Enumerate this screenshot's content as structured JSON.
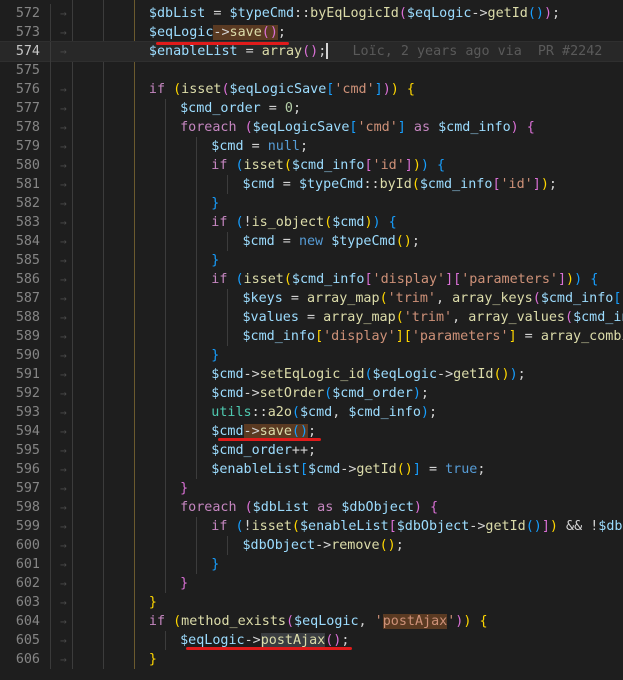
{
  "editor": {
    "current_line": 574,
    "blame": "Loïc, 2 years ago via  PR #2242",
    "lines": [
      {
        "n": "572",
        "arrows": 3,
        "tokens": [
          [
            "$dbList",
            "t-var"
          ],
          [
            " = ",
            "t-pl"
          ],
          [
            "$typeCmd",
            "t-var"
          ],
          [
            "::",
            "t-pl"
          ],
          [
            "byEqLogicId",
            "t-fn"
          ],
          [
            "(",
            "t-b2"
          ],
          [
            "$eqLogic",
            "t-var"
          ],
          [
            "->",
            "t-pl"
          ],
          [
            "getId",
            "t-fn"
          ],
          [
            "()",
            "t-b3"
          ],
          [
            ")",
            "t-b2"
          ],
          [
            ";",
            "t-pl"
          ]
        ]
      },
      {
        "n": "573",
        "arrows": 3,
        "tokens": [
          [
            "$eqLogic",
            "t-var"
          ],
          [
            "->",
            "t-pl hl-warm"
          ],
          [
            "save",
            "t-fn hl-warm"
          ],
          [
            "()",
            "t-b2 hl-warm"
          ],
          [
            ";",
            "t-pl"
          ]
        ]
      },
      {
        "n": "574",
        "arrows": 3,
        "tokens": [
          [
            "$enableList",
            "t-var"
          ],
          [
            " = ",
            "t-pl"
          ],
          [
            "array",
            "t-fn"
          ],
          [
            "()",
            "t-b2"
          ],
          [
            ";",
            "t-pl"
          ]
        ]
      },
      {
        "n": "575",
        "arrows": 0,
        "tokens": []
      },
      {
        "n": "576",
        "arrows": 3,
        "tokens": [
          [
            "if",
            "t-kw"
          ],
          [
            " ",
            "t-pl"
          ],
          [
            "(",
            "t-b1"
          ],
          [
            "isset",
            "t-fn"
          ],
          [
            "(",
            "t-b2"
          ],
          [
            "$eqLogicSave",
            "t-var"
          ],
          [
            "[",
            "t-b3"
          ],
          [
            "'cmd'",
            "t-str"
          ],
          [
            "]",
            "t-b3"
          ],
          [
            ")",
            "t-b2"
          ],
          [
            ")",
            "t-b1"
          ],
          [
            " ",
            "t-pl"
          ],
          [
            "{",
            "t-b1"
          ]
        ]
      },
      {
        "n": "577",
        "arrows": 4,
        "tokens": [
          [
            "$cmd_order",
            "t-var"
          ],
          [
            " = ",
            "t-pl"
          ],
          [
            "0",
            "t-num"
          ],
          [
            ";",
            "t-pl"
          ]
        ]
      },
      {
        "n": "578",
        "arrows": 4,
        "tokens": [
          [
            "foreach",
            "t-kw"
          ],
          [
            " ",
            "t-pl"
          ],
          [
            "(",
            "t-b2"
          ],
          [
            "$eqLogicSave",
            "t-var"
          ],
          [
            "[",
            "t-b3"
          ],
          [
            "'cmd'",
            "t-str"
          ],
          [
            "]",
            "t-b3"
          ],
          [
            " ",
            "t-pl"
          ],
          [
            "as",
            "t-kw"
          ],
          [
            " ",
            "t-pl"
          ],
          [
            "$cmd_info",
            "t-var"
          ],
          [
            ")",
            "t-b2"
          ],
          [
            " ",
            "t-pl"
          ],
          [
            "{",
            "t-b2"
          ]
        ]
      },
      {
        "n": "579",
        "arrows": 5,
        "tokens": [
          [
            "$cmd",
            "t-var"
          ],
          [
            " = ",
            "t-pl"
          ],
          [
            "null",
            "t-lit"
          ],
          [
            ";",
            "t-pl"
          ]
        ]
      },
      {
        "n": "580",
        "arrows": 5,
        "tokens": [
          [
            "if",
            "t-kw"
          ],
          [
            " ",
            "t-pl"
          ],
          [
            "(",
            "t-b3"
          ],
          [
            "isset",
            "t-fn"
          ],
          [
            "(",
            "t-b1"
          ],
          [
            "$cmd_info",
            "t-var"
          ],
          [
            "[",
            "t-b2"
          ],
          [
            "'id'",
            "t-str"
          ],
          [
            "]",
            "t-b2"
          ],
          [
            ")",
            "t-b1"
          ],
          [
            ")",
            "t-b3"
          ],
          [
            " ",
            "t-pl"
          ],
          [
            "{",
            "t-b3"
          ]
        ]
      },
      {
        "n": "581",
        "arrows": 6,
        "tokens": [
          [
            "$cmd",
            "t-var"
          ],
          [
            " = ",
            "t-pl"
          ],
          [
            "$typeCmd",
            "t-var"
          ],
          [
            "::",
            "t-pl"
          ],
          [
            "byId",
            "t-fn"
          ],
          [
            "(",
            "t-b1"
          ],
          [
            "$cmd_info",
            "t-var"
          ],
          [
            "[",
            "t-b2"
          ],
          [
            "'id'",
            "t-str"
          ],
          [
            "]",
            "t-b2"
          ],
          [
            ")",
            "t-b1"
          ],
          [
            ";",
            "t-pl"
          ]
        ]
      },
      {
        "n": "582",
        "arrows": 5,
        "tokens": [
          [
            "}",
            "t-b3"
          ]
        ]
      },
      {
        "n": "583",
        "arrows": 5,
        "tokens": [
          [
            "if",
            "t-kw"
          ],
          [
            " ",
            "t-pl"
          ],
          [
            "(",
            "t-b3"
          ],
          [
            "!",
            "t-pl"
          ],
          [
            "is_object",
            "t-fn"
          ],
          [
            "(",
            "t-b1"
          ],
          [
            "$cmd",
            "t-var"
          ],
          [
            ")",
            "t-b1"
          ],
          [
            ")",
            "t-b3"
          ],
          [
            " ",
            "t-pl"
          ],
          [
            "{",
            "t-b3"
          ]
        ]
      },
      {
        "n": "584",
        "arrows": 6,
        "tokens": [
          [
            "$cmd",
            "t-var"
          ],
          [
            " = ",
            "t-pl"
          ],
          [
            "new",
            "t-lit"
          ],
          [
            " ",
            "t-pl"
          ],
          [
            "$typeCmd",
            "t-var"
          ],
          [
            "()",
            "t-b1"
          ],
          [
            ";",
            "t-pl"
          ]
        ]
      },
      {
        "n": "585",
        "arrows": 5,
        "tokens": [
          [
            "}",
            "t-b3"
          ]
        ]
      },
      {
        "n": "586",
        "arrows": 5,
        "tokens": [
          [
            "if",
            "t-kw"
          ],
          [
            " ",
            "t-pl"
          ],
          [
            "(",
            "t-b3"
          ],
          [
            "isset",
            "t-fn"
          ],
          [
            "(",
            "t-b1"
          ],
          [
            "$cmd_info",
            "t-var"
          ],
          [
            "[",
            "t-b2"
          ],
          [
            "'display'",
            "t-str"
          ],
          [
            "]",
            "t-b2"
          ],
          [
            "[",
            "t-b2"
          ],
          [
            "'parameters'",
            "t-str"
          ],
          [
            "]",
            "t-b2"
          ],
          [
            ")",
            "t-b1"
          ],
          [
            ")",
            "t-b3"
          ],
          [
            " ",
            "t-pl"
          ],
          [
            "{",
            "t-b3"
          ]
        ]
      },
      {
        "n": "587",
        "arrows": 6,
        "tokens": [
          [
            "$keys",
            "t-var"
          ],
          [
            " = ",
            "t-pl"
          ],
          [
            "array_map",
            "t-fn"
          ],
          [
            "(",
            "t-b1"
          ],
          [
            "'trim'",
            "t-str"
          ],
          [
            ", ",
            "t-pl"
          ],
          [
            "array_keys",
            "t-fn"
          ],
          [
            "(",
            "t-b2"
          ],
          [
            "$cmd_info",
            "t-var"
          ],
          [
            "[",
            "t-b3"
          ],
          [
            "'d",
            "t-str"
          ]
        ]
      },
      {
        "n": "588",
        "arrows": 6,
        "tokens": [
          [
            "$values",
            "t-var"
          ],
          [
            " = ",
            "t-pl"
          ],
          [
            "array_map",
            "t-fn"
          ],
          [
            "(",
            "t-b1"
          ],
          [
            "'trim'",
            "t-str"
          ],
          [
            ", ",
            "t-pl"
          ],
          [
            "array_values",
            "t-fn"
          ],
          [
            "(",
            "t-b2"
          ],
          [
            "$cmd_inf",
            "t-var"
          ]
        ]
      },
      {
        "n": "589",
        "arrows": 6,
        "tokens": [
          [
            "$cmd_info",
            "t-var"
          ],
          [
            "[",
            "t-b1"
          ],
          [
            "'display'",
            "t-str"
          ],
          [
            "]",
            "t-b1"
          ],
          [
            "[",
            "t-b1"
          ],
          [
            "'parameters'",
            "t-str"
          ],
          [
            "]",
            "t-b1"
          ],
          [
            " = ",
            "t-pl"
          ],
          [
            "array_combin",
            "t-fn"
          ]
        ]
      },
      {
        "n": "590",
        "arrows": 5,
        "tokens": [
          [
            "}",
            "t-b3"
          ]
        ]
      },
      {
        "n": "591",
        "arrows": 5,
        "tokens": [
          [
            "$cmd",
            "t-var"
          ],
          [
            "->",
            "t-pl"
          ],
          [
            "setEqLogic_id",
            "t-fn"
          ],
          [
            "(",
            "t-b3"
          ],
          [
            "$eqLogic",
            "t-var"
          ],
          [
            "->",
            "t-pl"
          ],
          [
            "getId",
            "t-fn"
          ],
          [
            "()",
            "t-b1"
          ],
          [
            ")",
            "t-b3"
          ],
          [
            ";",
            "t-pl"
          ]
        ]
      },
      {
        "n": "592",
        "arrows": 5,
        "tokens": [
          [
            "$cmd",
            "t-var"
          ],
          [
            "->",
            "t-pl"
          ],
          [
            "setOrder",
            "t-fn"
          ],
          [
            "(",
            "t-b3"
          ],
          [
            "$cmd_order",
            "t-var"
          ],
          [
            ")",
            "t-b3"
          ],
          [
            ";",
            "t-pl"
          ]
        ]
      },
      {
        "n": "593",
        "arrows": 5,
        "tokens": [
          [
            "utils",
            "t-cls"
          ],
          [
            "::",
            "t-pl"
          ],
          [
            "a2o",
            "t-fn"
          ],
          [
            "(",
            "t-b3"
          ],
          [
            "$cmd",
            "t-var"
          ],
          [
            ", ",
            "t-pl"
          ],
          [
            "$cmd_info",
            "t-var"
          ],
          [
            ")",
            "t-b3"
          ],
          [
            ";",
            "t-pl"
          ]
        ]
      },
      {
        "n": "594",
        "arrows": 5,
        "tokens": [
          [
            "$cmd",
            "t-var"
          ],
          [
            "->",
            "t-pl hl-warm"
          ],
          [
            "save",
            "t-fn hl-warm"
          ],
          [
            "()",
            "t-b3 hl-warm"
          ],
          [
            ";",
            "t-pl"
          ]
        ]
      },
      {
        "n": "595",
        "arrows": 5,
        "tokens": [
          [
            "$cmd_order",
            "t-var"
          ],
          [
            "++;",
            "t-pl"
          ]
        ]
      },
      {
        "n": "596",
        "arrows": 5,
        "tokens": [
          [
            "$enableList",
            "t-var"
          ],
          [
            "[",
            "t-b3"
          ],
          [
            "$cmd",
            "t-var"
          ],
          [
            "->",
            "t-pl"
          ],
          [
            "getId",
            "t-fn"
          ],
          [
            "()",
            "t-b1"
          ],
          [
            "]",
            "t-b3"
          ],
          [
            " = ",
            "t-pl"
          ],
          [
            "true",
            "t-lit"
          ],
          [
            ";",
            "t-pl"
          ]
        ]
      },
      {
        "n": "597",
        "arrows": 4,
        "tokens": [
          [
            "}",
            "t-b2"
          ]
        ]
      },
      {
        "n": "598",
        "arrows": 4,
        "tokens": [
          [
            "foreach",
            "t-kw"
          ],
          [
            " ",
            "t-pl"
          ],
          [
            "(",
            "t-b2"
          ],
          [
            "$dbList",
            "t-var"
          ],
          [
            " ",
            "t-pl"
          ],
          [
            "as",
            "t-kw"
          ],
          [
            " ",
            "t-pl"
          ],
          [
            "$dbObject",
            "t-var"
          ],
          [
            ")",
            "t-b2"
          ],
          [
            " ",
            "t-pl"
          ],
          [
            "{",
            "t-b2"
          ]
        ]
      },
      {
        "n": "599",
        "arrows": 5,
        "tokens": [
          [
            "if",
            "t-kw"
          ],
          [
            " ",
            "t-pl"
          ],
          [
            "(",
            "t-b3"
          ],
          [
            "!",
            "t-pl"
          ],
          [
            "isset",
            "t-fn"
          ],
          [
            "(",
            "t-b1"
          ],
          [
            "$enableList",
            "t-var"
          ],
          [
            "[",
            "t-b2"
          ],
          [
            "$dbObject",
            "t-var"
          ],
          [
            "->",
            "t-pl"
          ],
          [
            "getId",
            "t-fn"
          ],
          [
            "()",
            "t-b3"
          ],
          [
            "]",
            "t-b2"
          ],
          [
            ")",
            "t-b1"
          ],
          [
            " && ",
            "t-pl"
          ],
          [
            "!",
            "t-pl"
          ],
          [
            "$dbOb",
            "t-var"
          ]
        ]
      },
      {
        "n": "600",
        "arrows": 6,
        "tokens": [
          [
            "$dbObject",
            "t-var"
          ],
          [
            "->",
            "t-pl"
          ],
          [
            "remove",
            "t-fn"
          ],
          [
            "()",
            "t-b1"
          ],
          [
            ";",
            "t-pl"
          ]
        ]
      },
      {
        "n": "601",
        "arrows": 5,
        "tokens": [
          [
            "}",
            "t-b3"
          ]
        ]
      },
      {
        "n": "602",
        "arrows": 4,
        "tokens": [
          [
            "}",
            "t-b2"
          ]
        ]
      },
      {
        "n": "603",
        "arrows": 3,
        "tokens": [
          [
            "}",
            "t-b1"
          ]
        ]
      },
      {
        "n": "604",
        "arrows": 3,
        "tokens": [
          [
            "if",
            "t-kw"
          ],
          [
            " ",
            "t-pl"
          ],
          [
            "(",
            "t-b1"
          ],
          [
            "method_exists",
            "t-fn"
          ],
          [
            "(",
            "t-b2"
          ],
          [
            "$eqLogic",
            "t-var"
          ],
          [
            ", ",
            "t-pl"
          ],
          [
            "'",
            "t-str"
          ],
          [
            "postAjax",
            "t-str hl-warm"
          ],
          [
            "'",
            "t-str"
          ],
          [
            ")",
            "t-b2"
          ],
          [
            ")",
            "t-b1"
          ],
          [
            " ",
            "t-pl"
          ],
          [
            "{",
            "t-b1"
          ]
        ]
      },
      {
        "n": "605",
        "arrows": 4,
        "tokens": [
          [
            "$eqLogic",
            "t-var"
          ],
          [
            "->",
            "t-pl"
          ],
          [
            "postAjax",
            "t-fn hl-sel"
          ],
          [
            "()",
            "t-b2"
          ],
          [
            ";",
            "t-pl"
          ]
        ]
      },
      {
        "n": "606",
        "arrows": 3,
        "tokens": [
          [
            "}",
            "t-b1"
          ]
        ]
      }
    ]
  }
}
